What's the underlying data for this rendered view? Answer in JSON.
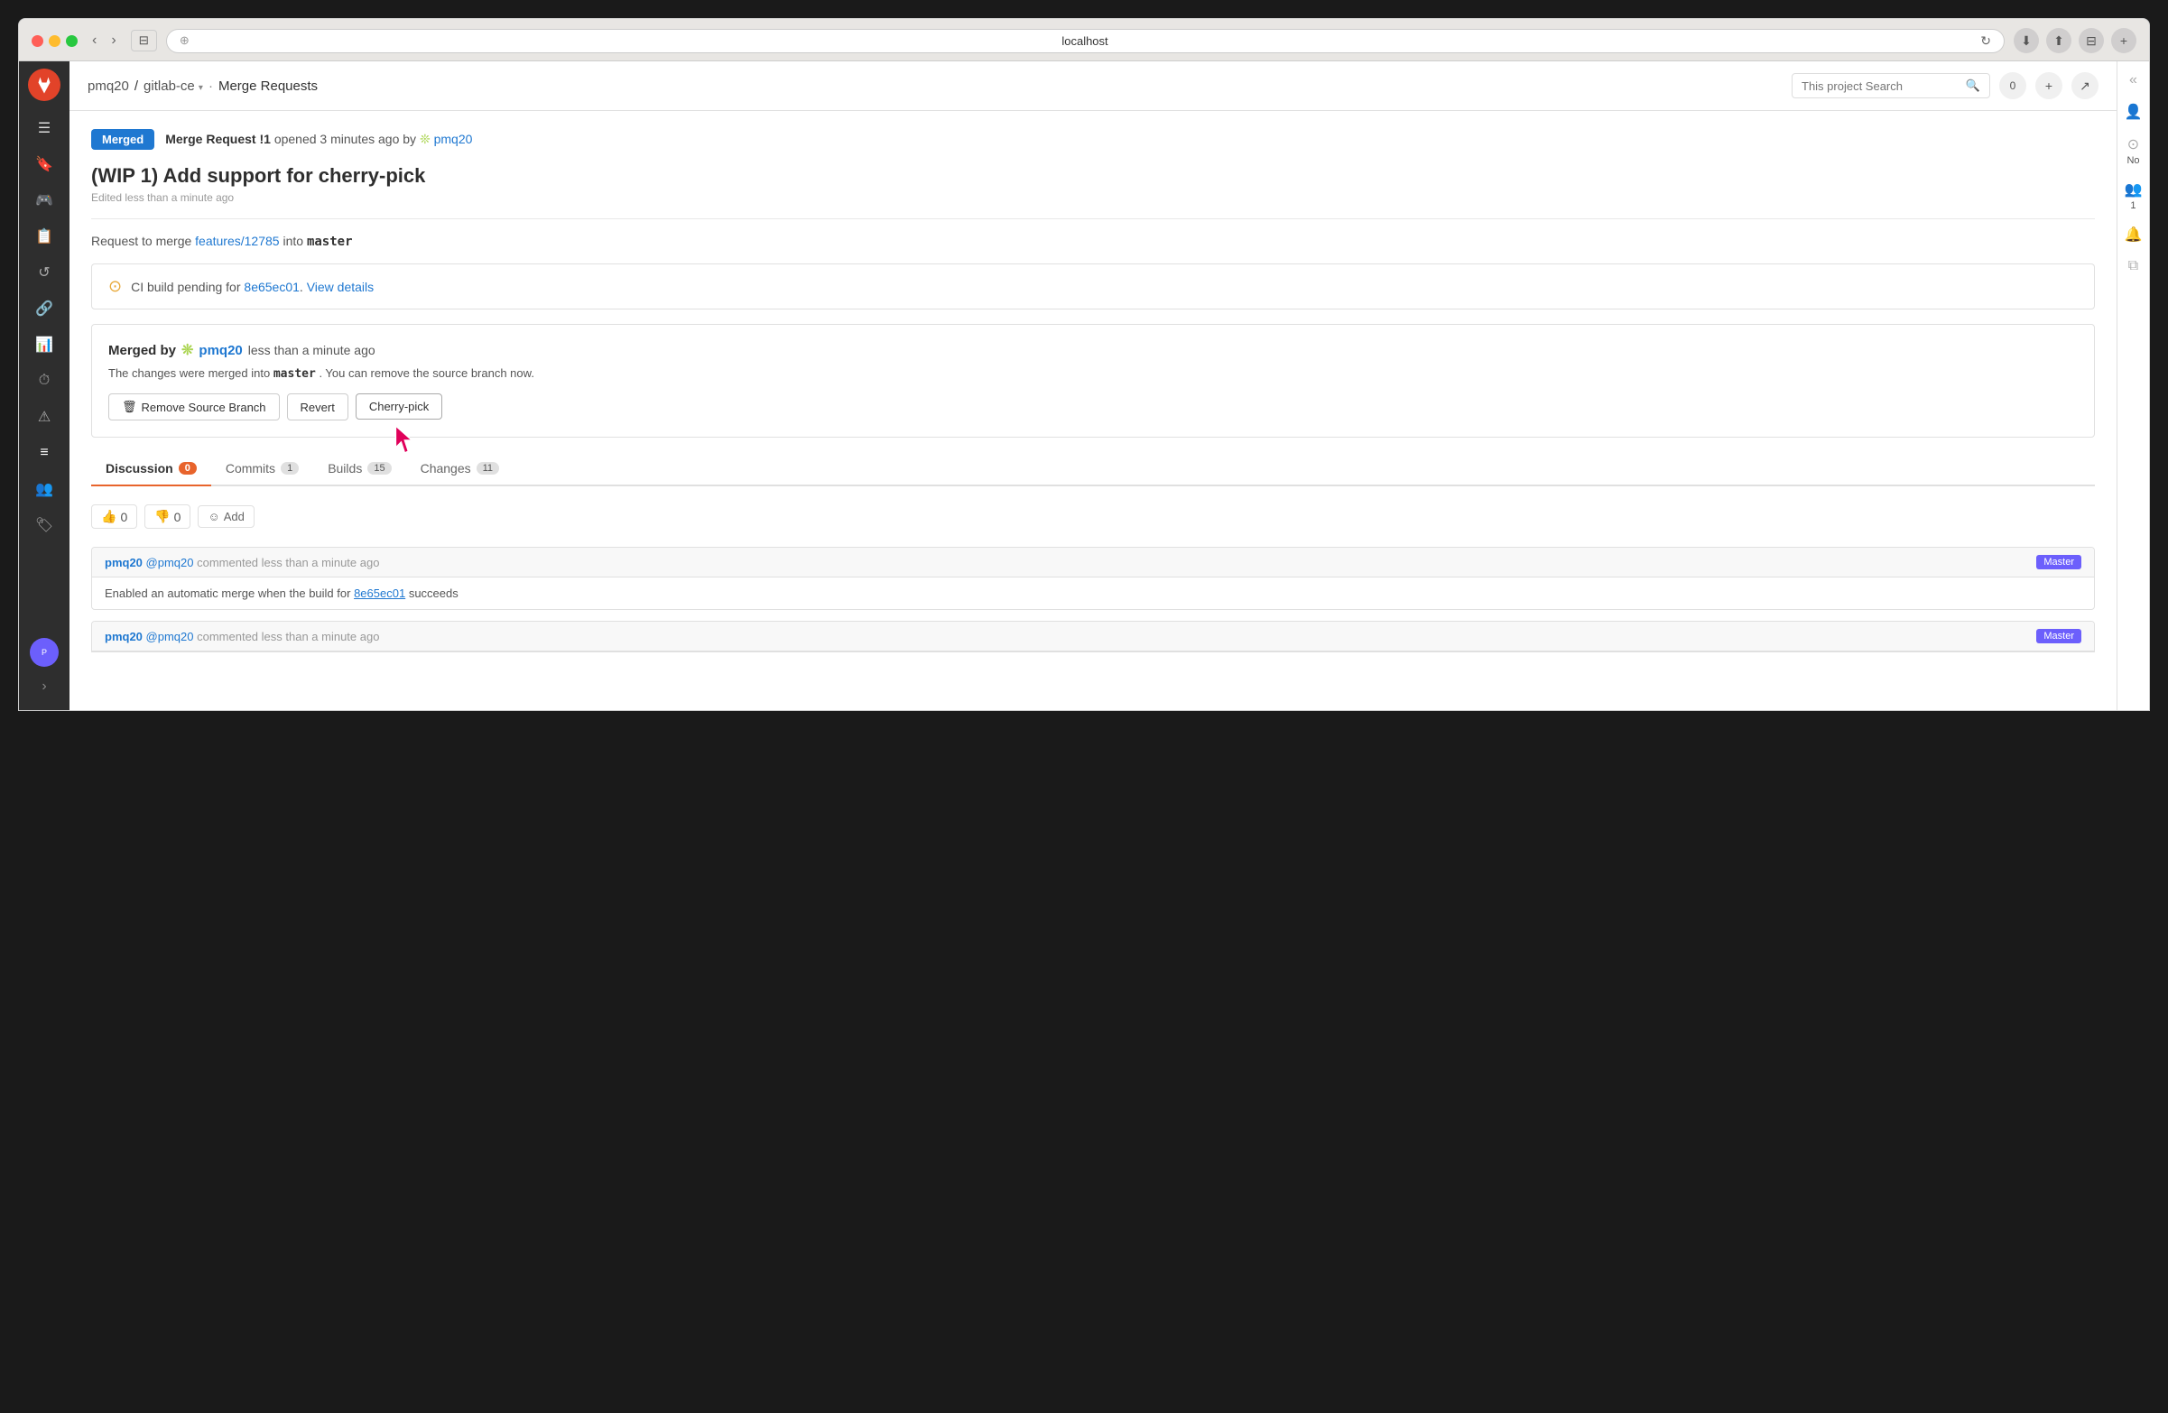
{
  "browser": {
    "url": "localhost",
    "tab_icon": "⊕"
  },
  "sidebar": {
    "logo": "🦊",
    "items": [
      {
        "icon": "☰",
        "name": "menu"
      },
      {
        "icon": "🔖",
        "name": "bookmark"
      },
      {
        "icon": "🎮",
        "name": "games"
      },
      {
        "icon": "📋",
        "name": "issues"
      },
      {
        "icon": "🔄",
        "name": "history"
      },
      {
        "icon": "🔗",
        "name": "merge"
      },
      {
        "icon": "📊",
        "name": "charts"
      },
      {
        "icon": "⏱",
        "name": "time"
      },
      {
        "icon": "⚠",
        "name": "alerts"
      },
      {
        "icon": "≡",
        "name": "list",
        "active": true
      },
      {
        "icon": "👥",
        "name": "team"
      },
      {
        "icon": "🏷",
        "name": "tags"
      }
    ]
  },
  "topnav": {
    "breadcrumb_user": "pmq20",
    "breadcrumb_project": "gitlab-ce",
    "breadcrumb_section": "Merge Requests",
    "search_placeholder": "This project Search",
    "notification_count": "0"
  },
  "mr": {
    "status": "Merged",
    "title_prefix": "!1",
    "opened_text": "opened 3 minutes ago by",
    "author": "pmq20",
    "title": "(WIP 1) Add support for cherry-pick",
    "edited_text": "Edited less than a minute ago",
    "merge_from": "features/12785",
    "merge_into": "master",
    "ci_text": "CI build pending for",
    "ci_commit": "8e65ec01",
    "ci_link_text": "View details",
    "merged_by_label": "Merged by",
    "merged_by_user": "pmq20",
    "merged_time": "less than a minute ago",
    "merged_message": "The changes were merged into",
    "merged_branch": "master",
    "merged_message2": ". You can remove the source branch now.",
    "btn_remove": "Remove Source Branch",
    "btn_revert": "Revert",
    "btn_cherry_pick": "Cherry-pick"
  },
  "tabs": [
    {
      "label": "Discussion",
      "count": "0",
      "active": true
    },
    {
      "label": "Commits",
      "count": "1",
      "active": false
    },
    {
      "label": "Builds",
      "count": "15",
      "active": false
    },
    {
      "label": "Changes",
      "count": "11",
      "active": false
    }
  ],
  "reactions": {
    "thumbs_up": "👍",
    "thumbs_up_count": "0",
    "thumbs_down": "👎",
    "thumbs_down_count": "0",
    "add_label": "Add"
  },
  "comments": [
    {
      "author": "pmq20",
      "at_user": "@pmq20",
      "action": "commented less than a minute ago",
      "label": "Master",
      "body_text": "Enabled an automatic merge when the build for",
      "body_commit": "8e65ec01",
      "body_suffix": "succeeds"
    },
    {
      "author": "pmq20",
      "at_user": "@pmq20",
      "action": "commented less than a minute ago",
      "label": "Master",
      "body_text": ""
    }
  ],
  "right_sidebar": {
    "no_label": "No",
    "count_1": "1"
  }
}
